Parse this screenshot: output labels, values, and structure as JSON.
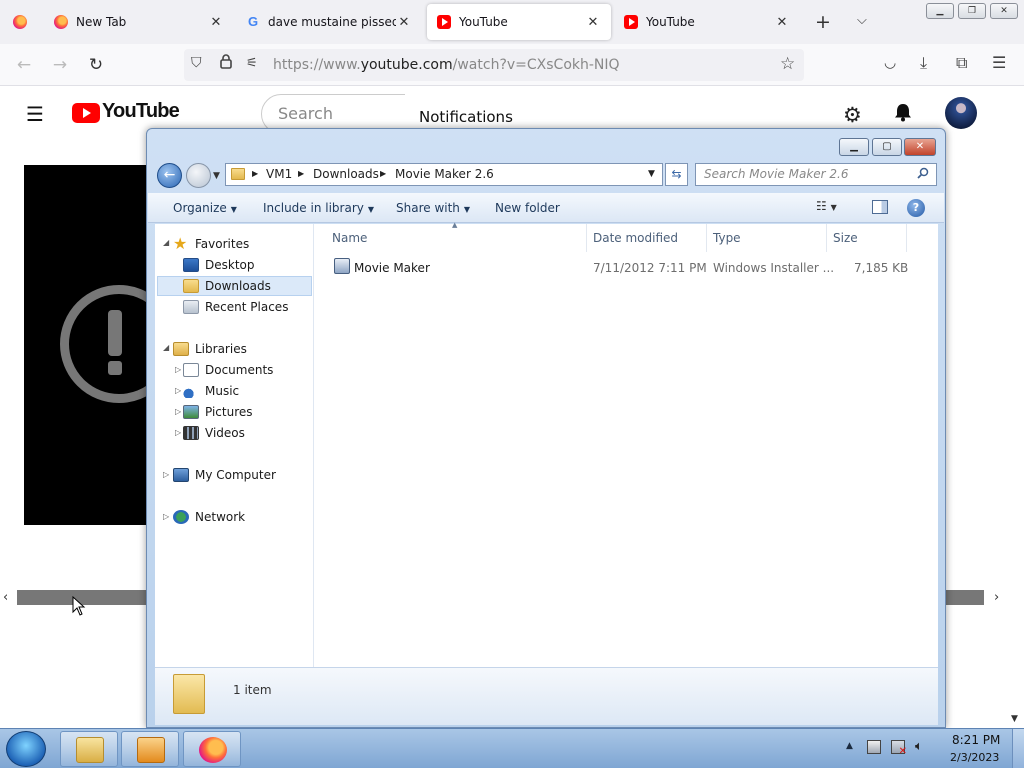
{
  "browser": {
    "tabs": [
      {
        "title": "New Tab",
        "favicon": "firefox-icon"
      },
      {
        "title": "dave mustaine pissed off",
        "favicon": "google-icon"
      },
      {
        "title": "YouTube",
        "favicon": "youtube-icon",
        "selected": true
      },
      {
        "title": "YouTube",
        "favicon": "youtube-icon"
      }
    ],
    "new_tab_symbol": "+",
    "url_prefix": "https://www.",
    "url_domain": "youtube.com",
    "url_suffix": "/watch?v=CXsCokh-NIQ"
  },
  "youtube": {
    "logo_text": "YouTube",
    "search_placeholder": "Search",
    "notifications_title": "Notifications"
  },
  "explorer": {
    "breadcrumb": [
      "VM1",
      "Downloads",
      "Movie Maker 2.6"
    ],
    "search_placeholder": "Search Movie Maker 2.6",
    "commands": {
      "organize": "Organize",
      "include_in_library": "Include in library",
      "share_with": "Share with",
      "new_folder": "New folder"
    },
    "nav": {
      "favorites": "Favorites",
      "desktop": "Desktop",
      "downloads": "Downloads",
      "recent_places": "Recent Places",
      "libraries": "Libraries",
      "documents": "Documents",
      "music": "Music",
      "pictures": "Pictures",
      "videos": "Videos",
      "my_computer": "My Computer",
      "network": "Network"
    },
    "columns": {
      "name": "Name",
      "date_modified": "Date modified",
      "type": "Type",
      "size": "Size"
    },
    "files": [
      {
        "name": "Movie Maker",
        "date_modified": "7/11/2012 7:11 PM",
        "type": "Windows Installer ...",
        "size": "7,185 KB"
      }
    ],
    "item_count": "1 item"
  },
  "taskbar": {
    "time": "8:21 PM",
    "date": "2/3/2023",
    "pinned": [
      "windows-explorer-icon",
      "media-player-icon",
      "firefox-icon"
    ]
  }
}
